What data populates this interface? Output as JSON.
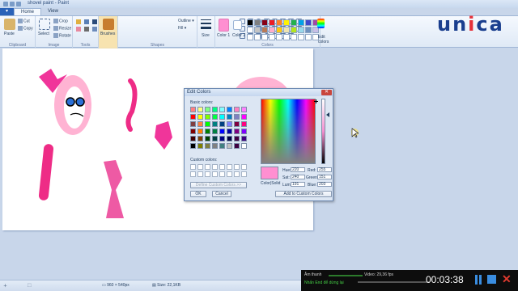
{
  "window": {
    "title": "shovel paint - Paint"
  },
  "tabs": {
    "file": "",
    "home": "Home",
    "view": "View"
  },
  "ribbon": {
    "clipboard": {
      "paste": "Paste",
      "cut": "Cut",
      "copy": "Copy",
      "group": "Clipboard"
    },
    "image": {
      "select": "Select",
      "crop": "Crop",
      "resize": "Resize",
      "rotate": "Rotate",
      "group": "Image"
    },
    "tools": {
      "group": "Tools"
    },
    "brushes": {
      "label": "Brushes"
    },
    "shapes": {
      "outline": "Outline",
      "fill": "Fill",
      "group": "Shapes"
    },
    "size": {
      "label": "Size"
    },
    "colors": {
      "color1": "Color 1",
      "color2": "Color 2",
      "edit": "Edit colors",
      "group": "Colors",
      "palette": [
        "#000000",
        "#7f7f7f",
        "#880015",
        "#ed1c24",
        "#ff7f27",
        "#fff200",
        "#22b14c",
        "#00a2e8",
        "#3f48cc",
        "#a349a4",
        "#ffffff",
        "#c3c3c3",
        "#b97a57",
        "#ffaec9",
        "#ffc90e",
        "#efe4b0",
        "#b5e61d",
        "#99d9ea",
        "#7092be",
        "#c8bfe7",
        "#ffffff",
        "#ffffff",
        "#ffffff",
        "#ffffff",
        "#ffffff",
        "#ffffff",
        "#ffffff",
        "#ffffff",
        "#ffffff",
        "#ffffff"
      ]
    }
  },
  "dialog": {
    "title": "Edit Colors",
    "basic_label": "Basic colors:",
    "custom_label": "Custom colors:",
    "define_label": "Define Custom Colors >>",
    "ok": "OK",
    "cancel": "Cancel",
    "color_solid": "Color|Solid",
    "add_custom": "Add to Custom Colors",
    "hue_label": "Hue:",
    "hue": "220",
    "sat_label": "Sat:",
    "sat": "240",
    "lum_label": "Lum:",
    "lum": "191",
    "red_label": "Red:",
    "red": "255",
    "green_label": "Green:",
    "green": "151",
    "blue_label": "Blue:",
    "blue": "203",
    "basic_colors": [
      "#ff8080",
      "#ffff80",
      "#80ff80",
      "#00ff80",
      "#80ffff",
      "#0080ff",
      "#ff80c0",
      "#ff80ff",
      "#ff0000",
      "#ffff00",
      "#80ff00",
      "#00ff40",
      "#00ffff",
      "#0080c0",
      "#8080c0",
      "#ff00ff",
      "#804040",
      "#ff8040",
      "#00ff00",
      "#008080",
      "#004080",
      "#8080ff",
      "#800040",
      "#ff0080",
      "#800000",
      "#ff8000",
      "#008000",
      "#008040",
      "#0000ff",
      "#0000a0",
      "#800080",
      "#8000ff",
      "#400000",
      "#804000",
      "#004000",
      "#004040",
      "#000080",
      "#000040",
      "#400040",
      "#400080",
      "#000000",
      "#808000",
      "#808040",
      "#808080",
      "#408080",
      "#c0c0c0",
      "#400040",
      "#ffffff"
    ]
  },
  "status": {
    "dimensions": "960 × 540px",
    "size": "Size: 22,1KB"
  },
  "player": {
    "audio": "Âm thanh",
    "video": "Video: 29,36 fps",
    "hint": "Nhấn End để dừng lại",
    "time": "00:03:38"
  },
  "logo": {
    "text_a": "un",
    "text_b": "i",
    "text_c": "ca"
  },
  "accent": {
    "ribbon_blue": "#2a62b8",
    "pink": "#ff8fd1",
    "logo_blue": "#1a3e8e",
    "logo_red": "#e6313a"
  }
}
